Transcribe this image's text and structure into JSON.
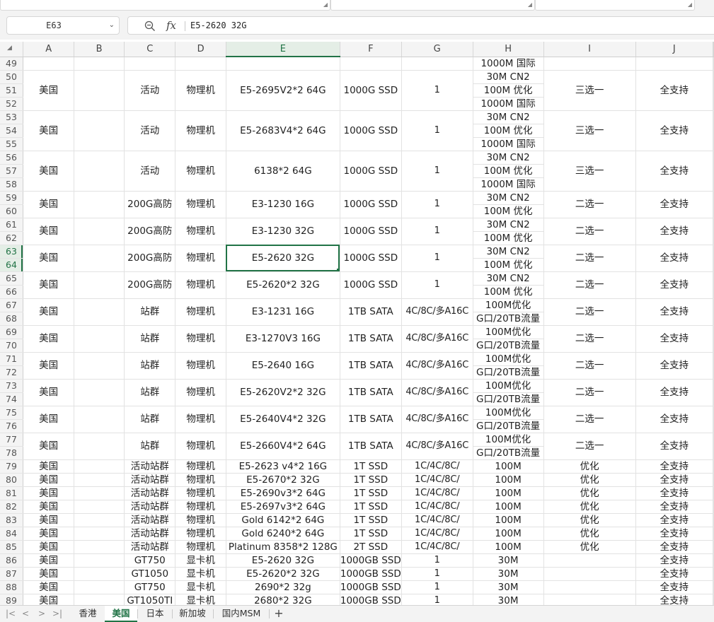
{
  "formula_bar": {
    "cell_ref": "E63",
    "fx_label": "fx",
    "content": "E5-2620 32G"
  },
  "columns": [
    "A",
    "B",
    "C",
    "D",
    "E",
    "F",
    "G",
    "H",
    "I",
    "J"
  ],
  "selected_column": "E",
  "selected_rows": [
    "63",
    "64"
  ],
  "groups": [
    {
      "rows": [
        "49"
      ],
      "cells": [
        "",
        "",
        "",
        "",
        "",
        "",
        "",
        ""
      ],
      "h": [
        "1000M 国际"
      ],
      "i": "",
      "j": ""
    },
    {
      "rows": [
        "50",
        "51",
        "52"
      ],
      "a": "美国",
      "c": "活动",
      "d": "物理机",
      "e": "E5-2695V2*2 64G",
      "f": "1000G SSD",
      "g": "1",
      "h": [
        "30M CN2",
        "100M 优化",
        "1000M 国际"
      ],
      "i": "三选一",
      "j": "全支持"
    },
    {
      "rows": [
        "53",
        "54",
        "55"
      ],
      "a": "美国",
      "c": "活动",
      "d": "物理机",
      "e": "E5-2683V4*2 64G",
      "f": "1000G SSD",
      "g": "1",
      "h": [
        "30M CN2",
        "100M 优化",
        "1000M 国际"
      ],
      "i": "三选一",
      "j": "全支持"
    },
    {
      "rows": [
        "56",
        "57",
        "58"
      ],
      "a": "美国",
      "c": "活动",
      "d": "物理机",
      "e": "6138*2 64G",
      "f": "1000G SSD",
      "g": "1",
      "h": [
        "30M CN2",
        "100M 优化",
        "1000M 国际"
      ],
      "i": "三选一",
      "j": "全支持"
    },
    {
      "rows": [
        "59",
        "60"
      ],
      "a": "美国",
      "c": "200G高防",
      "d": "物理机",
      "e": "E3-1230 16G",
      "f": "1000G SSD",
      "g": "1",
      "h": [
        "30M CN2",
        "100M 优化"
      ],
      "i": "二选一",
      "j": "全支持"
    },
    {
      "rows": [
        "61",
        "62"
      ],
      "a": "美国",
      "c": "200G高防",
      "d": "物理机",
      "e": "E3-1230 32G",
      "f": "1000G SSD",
      "g": "1",
      "h": [
        "30M CN2",
        "100M 优化"
      ],
      "i": "二选一",
      "j": "全支持"
    },
    {
      "rows": [
        "63",
        "64"
      ],
      "a": "美国",
      "c": "200G高防",
      "d": "物理机",
      "e": "E5-2620 32G",
      "f": "1000G SSD",
      "g": "1",
      "h": [
        "30M CN2",
        "100M 优化"
      ],
      "i": "二选一",
      "j": "全支持",
      "selected": true
    },
    {
      "rows": [
        "65",
        "66"
      ],
      "a": "美国",
      "c": "200G高防",
      "d": "物理机",
      "e": "E5-2620*2 32G",
      "f": "1000G SSD",
      "g": "1",
      "h": [
        "30M CN2",
        "100M 优化"
      ],
      "i": "二选一",
      "j": "全支持"
    },
    {
      "rows": [
        "67",
        "68"
      ],
      "a": "美国",
      "c": "站群",
      "d": "物理机",
      "e": "E3-1231 16G",
      "f": "1TB SATA",
      "g": "4C/8C/多A16C",
      "h": [
        "100M优化",
        "G口/20TB流量"
      ],
      "i": "二选一",
      "j": "全支持"
    },
    {
      "rows": [
        "69",
        "70"
      ],
      "a": "美国",
      "c": "站群",
      "d": "物理机",
      "e": "E3-1270V3 16G",
      "f": "1TB SATA",
      "g": "4C/8C/多A16C",
      "h": [
        "100M优化",
        "G口/20TB流量"
      ],
      "i": "二选一",
      "j": "全支持"
    },
    {
      "rows": [
        "71",
        "72"
      ],
      "a": "美国",
      "c": "站群",
      "d": "物理机",
      "e": "E5-2640 16G",
      "f": "1TB SATA",
      "g": "4C/8C/多A16C",
      "h": [
        "100M优化",
        "G口/20TB流量"
      ],
      "i": "二选一",
      "j": "全支持"
    },
    {
      "rows": [
        "73",
        "74"
      ],
      "a": "美国",
      "c": "站群",
      "d": "物理机",
      "e": "E5-2620V2*2 32G",
      "f": "1TB SATA",
      "g": "4C/8C/多A16C",
      "h": [
        "100M优化",
        "G口/20TB流量"
      ],
      "i": "二选一",
      "j": "全支持"
    },
    {
      "rows": [
        "75",
        "76"
      ],
      "a": "美国",
      "c": "站群",
      "d": "物理机",
      "e": "E5-2640V4*2 32G",
      "f": "1TB SATA",
      "g": "4C/8C/多A16C",
      "h": [
        "100M优化",
        "G口/20TB流量"
      ],
      "i": "二选一",
      "j": "全支持"
    },
    {
      "rows": [
        "77",
        "78"
      ],
      "a": "美国",
      "c": "站群",
      "d": "物理机",
      "e": "E5-2660V4*2 64G",
      "f": "1TB SATA",
      "g": "4C/8C/多A16C",
      "h": [
        "100M优化",
        "G口/20TB流量"
      ],
      "i": "二选一",
      "j": "全支持"
    },
    {
      "rows": [
        "79"
      ],
      "a": "美国",
      "c": "活动站群",
      "d": "物理机",
      "e": "E5-2623 v4*2 16G",
      "f": "1T SSD",
      "g": "1C/4C/8C/",
      "h": [
        "100M"
      ],
      "i": "优化",
      "j": "全支持"
    },
    {
      "rows": [
        "80"
      ],
      "a": "美国",
      "c": "活动站群",
      "d": "物理机",
      "e": "E5-2670*2 32G",
      "f": "1T SSD",
      "g": "1C/4C/8C/",
      "h": [
        "100M"
      ],
      "i": "优化",
      "j": "全支持"
    },
    {
      "rows": [
        "81"
      ],
      "a": "美国",
      "c": "活动站群",
      "d": "物理机",
      "e": "E5-2690v3*2 64G",
      "f": "1T SSD",
      "g": "1C/4C/8C/",
      "h": [
        "100M"
      ],
      "i": "优化",
      "j": "全支持"
    },
    {
      "rows": [
        "82"
      ],
      "a": "美国",
      "c": "活动站群",
      "d": "物理机",
      "e": "E5-2697v3*2 64G",
      "f": "1T SSD",
      "g": "1C/4C/8C/",
      "h": [
        "100M"
      ],
      "i": "优化",
      "j": "全支持"
    },
    {
      "rows": [
        "83"
      ],
      "a": "美国",
      "c": "活动站群",
      "d": "物理机",
      "e": "Gold 6142*2 64G",
      "f": "1T SSD",
      "g": "1C/4C/8C/",
      "h": [
        "100M"
      ],
      "i": "优化",
      "j": "全支持"
    },
    {
      "rows": [
        "84"
      ],
      "a": "美国",
      "c": "活动站群",
      "d": "物理机",
      "e": "Gold 6240*2 64G",
      "f": "1T SSD",
      "g": "1C/4C/8C/",
      "h": [
        "100M"
      ],
      "i": "优化",
      "j": "全支持"
    },
    {
      "rows": [
        "85"
      ],
      "a": "美国",
      "c": "活动站群",
      "d": "物理机",
      "e": "Platinum 8358*2 128G",
      "f": "2T SSD",
      "g": "1C/4C/8C/",
      "h": [
        "100M"
      ],
      "i": "优化",
      "j": "全支持"
    },
    {
      "rows": [
        "86"
      ],
      "a": "美国",
      "c": "GT750",
      "d": "显卡机",
      "e": "E5-2620 32G",
      "f": "1000GB SSD",
      "g": "1",
      "h": [
        "30M"
      ],
      "i": "",
      "j": "全支持"
    },
    {
      "rows": [
        "87"
      ],
      "a": "美国",
      "c": "GT1050",
      "d": "显卡机",
      "e": "E5-2620*2 32G",
      "f": "1000GB SSD",
      "g": "1",
      "h": [
        "30M"
      ],
      "i": "",
      "j": "全支持"
    },
    {
      "rows": [
        "88"
      ],
      "a": "美国",
      "c": "GT750",
      "d": "显卡机",
      "e": "2690*2 32g",
      "f": "1000GB SSD",
      "g": "1",
      "h": [
        "30M"
      ],
      "i": "",
      "j": "全支持"
    },
    {
      "rows": [
        "89"
      ],
      "a": "美国",
      "c": "GT1050TI",
      "d": "显卡机",
      "e": "2680*2 32G",
      "f": "1000GB SSD",
      "g": "1",
      "h": [
        "30M"
      ],
      "i": "",
      "j": "全支持"
    }
  ],
  "sheet_tabs": [
    {
      "label": "香港",
      "active": false
    },
    {
      "label": "美国",
      "active": true
    },
    {
      "label": "日本",
      "active": false
    },
    {
      "label": "新加坡",
      "active": false
    },
    {
      "label": "国内MSM",
      "active": false
    }
  ],
  "add_sheet_label": "+",
  "colors": {
    "accent": "#217346"
  }
}
